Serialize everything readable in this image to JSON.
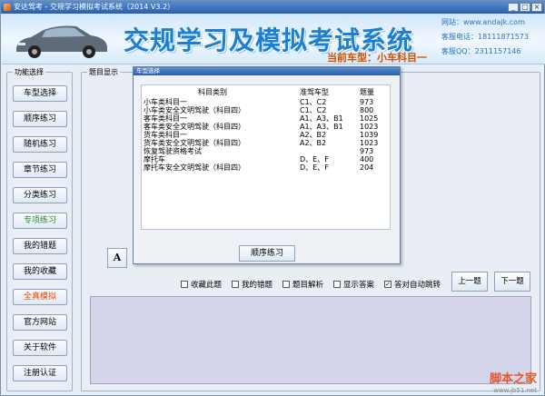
{
  "window": {
    "title": "安达驾考 - 交规学习模拟考试系统（2014 V3.2）",
    "controls": [
      "_",
      "□",
      "×"
    ]
  },
  "banner": {
    "title": "交规学习及模拟考试系统",
    "car_type": "当前车型：小车科目一",
    "website": "网站：www.andajk.com",
    "phone": "客服电话：18111871573",
    "qq": "客服QQ：2311157146"
  },
  "left": {
    "legend": "功能选择",
    "buttons": [
      "车型选择",
      "顺序练习",
      "随机练习",
      "章节练习",
      "分类练习",
      "专项练习",
      "我的错题",
      "我的收藏",
      "全真模拟",
      "官方网站",
      "关于软件",
      "注册认证"
    ]
  },
  "question": {
    "legend": "题目显示",
    "font_button": "A",
    "options": [
      "收藏此题",
      "我的错题",
      "题目解析",
      "显示答案",
      "答对自动跳转"
    ],
    "options_checked": [
      false,
      false,
      false,
      false,
      true
    ],
    "prev": "上一题",
    "next": "下一题"
  },
  "dialog": {
    "title": "车型选择",
    "headers": [
      "科目类别",
      "准驾车型",
      "题量"
    ],
    "rows": [
      [
        "小车类科目一",
        "C1、C2",
        "973"
      ],
      [
        "小车类安全文明驾驶（科目四）",
        "C1、C2",
        "800"
      ],
      [
        "客车类科目一",
        "A1、A3、B1",
        "1025"
      ],
      [
        "客车类安全文明驾驶（科目四）",
        "A1、A3、B1",
        "1023"
      ],
      [
        "货车类科目一",
        "A2、B2",
        "1039"
      ],
      [
        "货车类安全文明驾驶（科目四）",
        "A2、B2",
        "1023"
      ],
      [
        "恢复驾驶资格考试",
        "",
        "973"
      ],
      [
        "摩托车",
        "D、E、F",
        "400"
      ],
      [
        "摩托车安全文明驾驶（科目四）",
        "D、E、F",
        "204"
      ]
    ],
    "button": "顺序练习"
  },
  "watermark": {
    "text": "脚本之家",
    "url": "www.jb51.net"
  }
}
